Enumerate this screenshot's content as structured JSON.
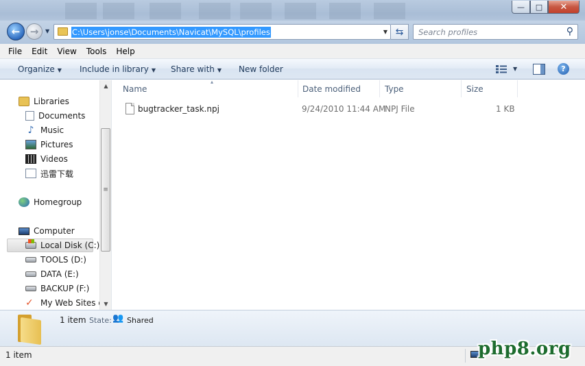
{
  "address": {
    "path": "C:\\Users\\jonse\\Documents\\Navicat\\MySQL\\profiles"
  },
  "search": {
    "placeholder": "Search profiles"
  },
  "window": {
    "min": "—",
    "max": "□",
    "close": "✕"
  },
  "menu": [
    "File",
    "Edit",
    "View",
    "Tools",
    "Help"
  ],
  "commands": {
    "organize": "Organize",
    "include_in_library": "Include in library",
    "share_with": "Share with",
    "new_folder": "New folder"
  },
  "sidebar": {
    "libraries": "Libraries",
    "library_items": [
      "Documents",
      "Music",
      "Pictures",
      "Videos",
      "迅雷下载"
    ],
    "homegroup": "Homegroup",
    "computer": "Computer",
    "drives": [
      "Local Disk (C:)",
      "TOOLS (D:)",
      "DATA (E:)",
      "BACKUP (F:)",
      "My Web Sites on"
    ]
  },
  "columns": {
    "name": "Name",
    "date_modified": "Date modified",
    "type": "Type",
    "size": "Size"
  },
  "files": [
    {
      "name": "bugtracker_task.npj",
      "date_modified": "9/24/2010 11:44 AM",
      "type": "NPJ File",
      "size": "1 KB"
    }
  ],
  "details": {
    "count": "1 item",
    "state_label": "State:",
    "state_value": "Shared"
  },
  "status": {
    "text": "1 item"
  },
  "watermark": "php8.org",
  "colors": {
    "selection": "#3399ff",
    "watermark": "#1d6c2e"
  }
}
